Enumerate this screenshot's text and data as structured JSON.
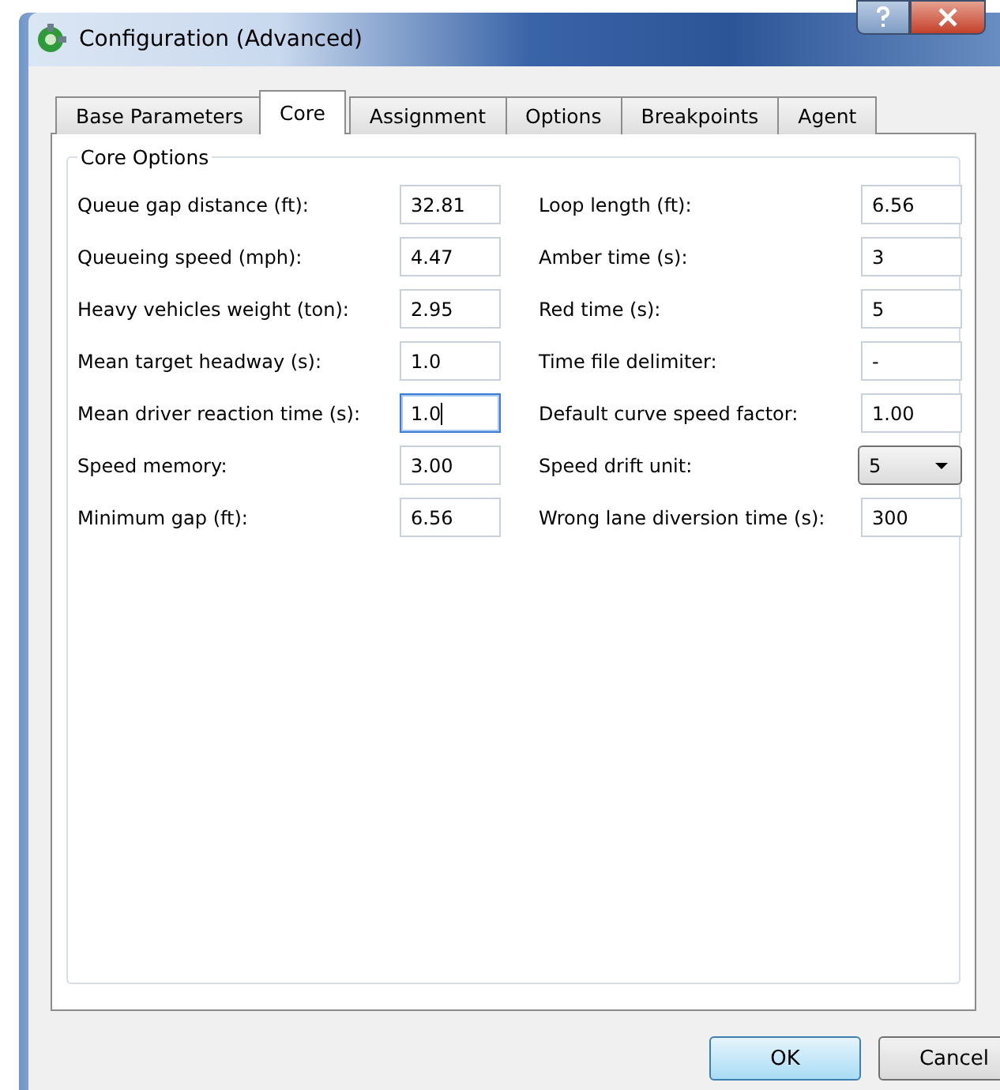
{
  "window": {
    "title": "Configuration (Advanced)"
  },
  "tabs": [
    {
      "label": "Base Parameters",
      "selected": false
    },
    {
      "label": "Core",
      "selected": true
    },
    {
      "label": "Assignment",
      "selected": false
    },
    {
      "label": "Options",
      "selected": false
    },
    {
      "label": "Breakpoints",
      "selected": false
    },
    {
      "label": "Agent",
      "selected": false
    }
  ],
  "group": {
    "title": "Core Options"
  },
  "left_fields": [
    {
      "label": "Queue gap distance (ft):",
      "value": "32.81",
      "kind": "text",
      "focused": false
    },
    {
      "label": "Queueing speed (mph):",
      "value": "4.47",
      "kind": "text",
      "focused": false
    },
    {
      "label": "Heavy vehicles weight (ton):",
      "value": "2.95",
      "kind": "text",
      "focused": false
    },
    {
      "label": "Mean target headway (s):",
      "value": "1.0",
      "kind": "text",
      "focused": false
    },
    {
      "label": "Mean driver reaction time (s):",
      "value": "1.0",
      "kind": "text",
      "focused": true
    },
    {
      "label": "Speed memory:",
      "value": "3.00",
      "kind": "text",
      "focused": false
    },
    {
      "label": "Minimum gap (ft):",
      "value": "6.56",
      "kind": "text",
      "focused": false
    }
  ],
  "right_fields": [
    {
      "label": "Loop length (ft):",
      "value": "6.56",
      "kind": "text",
      "focused": false
    },
    {
      "label": "Amber time (s):",
      "value": "3",
      "kind": "text",
      "focused": false
    },
    {
      "label": "Red time (s):",
      "value": "5",
      "kind": "text",
      "focused": false
    },
    {
      "label": "Time file delimiter:",
      "value": "-",
      "kind": "text",
      "focused": false
    },
    {
      "label": "Default curve speed factor:",
      "value": "1.00",
      "kind": "text",
      "focused": false
    },
    {
      "label": "Speed drift unit:",
      "value": "5",
      "kind": "dropdown"
    },
    {
      "label": "Wrong lane diversion time (s):",
      "value": "300",
      "kind": "text",
      "focused": false
    }
  ],
  "buttons": [
    {
      "label": "OK",
      "kind": "default"
    },
    {
      "label": "Cancel",
      "kind": "normal"
    }
  ]
}
